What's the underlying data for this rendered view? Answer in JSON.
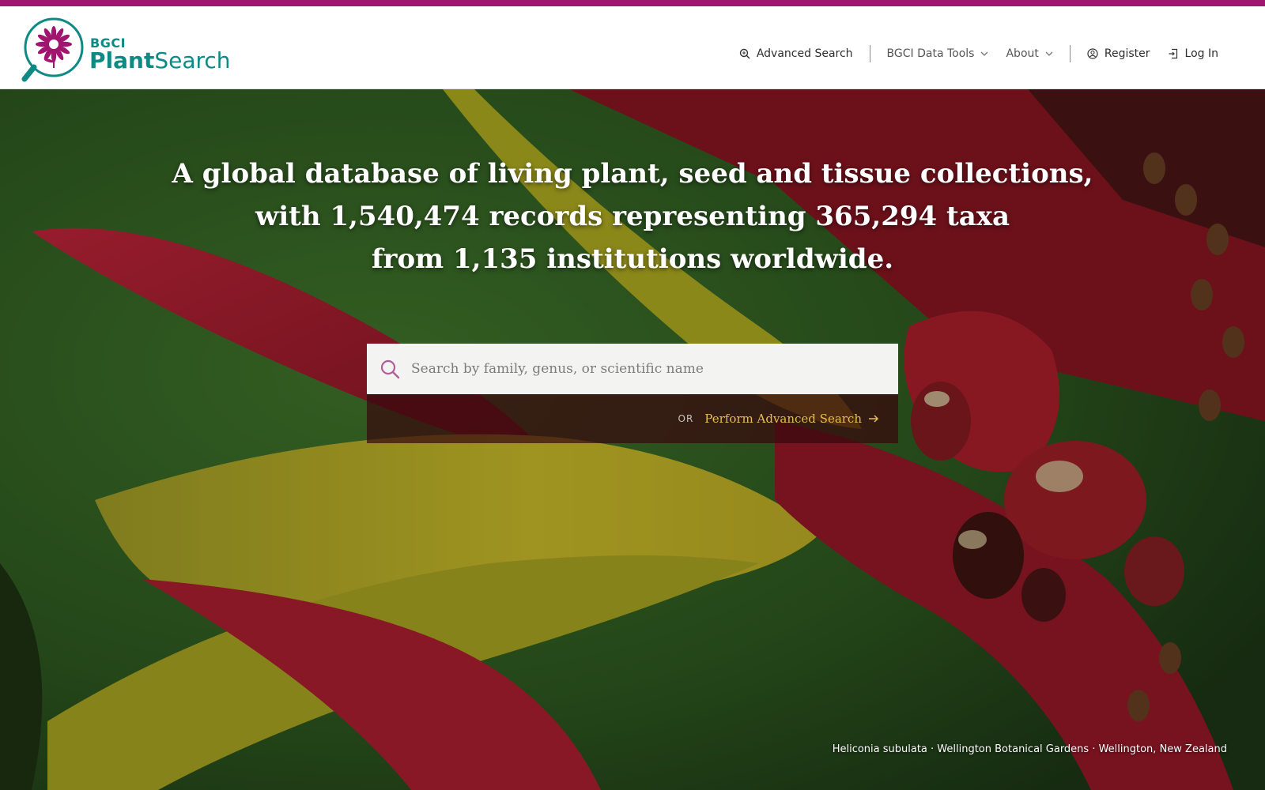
{
  "colors": {
    "accent": "#a0156e",
    "brand_teal": "#0d8a83",
    "link_gold": "#e8bf4e"
  },
  "header": {
    "logo": {
      "org": "BGCI",
      "name_bold": "Plant",
      "name_regular": "Search",
      "icon": "flower-magnifier-logo"
    },
    "nav": {
      "advanced_search": {
        "label": "Advanced Search",
        "icon": "search-icon"
      },
      "data_tools": {
        "label": "BGCI Data Tools",
        "icon": "chevron-down-icon"
      },
      "about": {
        "label": "About",
        "icon": "chevron-down-icon"
      },
      "register": {
        "label": "Register",
        "icon": "user-icon"
      },
      "login": {
        "label": "Log In",
        "icon": "login-icon"
      }
    }
  },
  "hero": {
    "headline": [
      "A global database of living plant, seed and tissue collections,",
      "with 1,540,474 records representing 365,294 taxa",
      "from 1,135 institutions worldwide."
    ],
    "search": {
      "placeholder": "Search by family, genus, or scientific name",
      "value": ""
    },
    "or_label": "OR",
    "advanced_link": "Perform Advanced Search",
    "photo_caption": "Heliconia subulata · Wellington Botanical Gardens · Wellington, New Zealand"
  }
}
